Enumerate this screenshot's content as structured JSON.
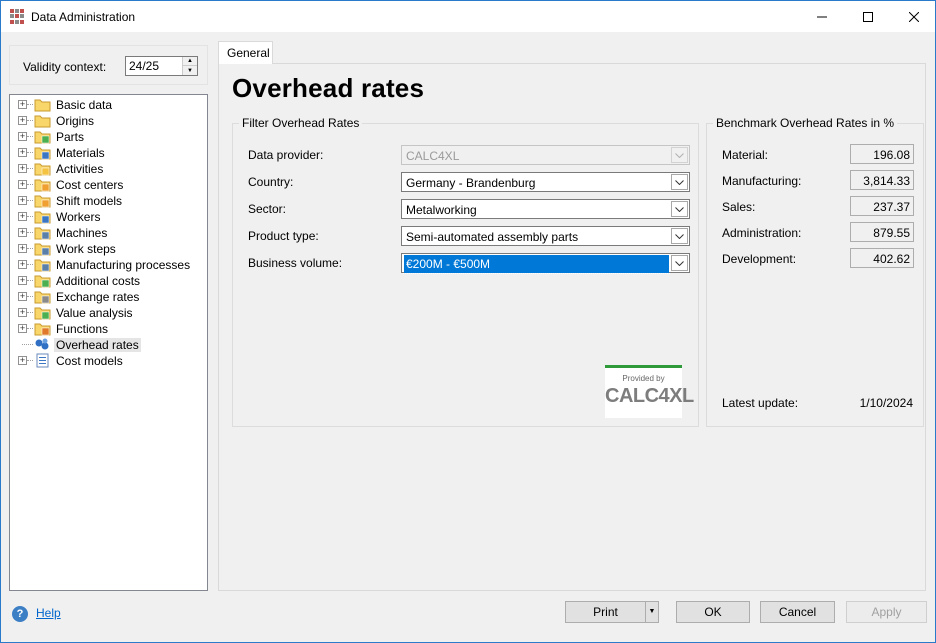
{
  "window": {
    "title": "Data Administration"
  },
  "validity": {
    "label": "Validity context:",
    "value": "24/25"
  },
  "tree": {
    "items": [
      {
        "label": "Basic data",
        "icon": "folder-icon"
      },
      {
        "label": "Origins",
        "icon": "folder-icon"
      },
      {
        "label": "Parts",
        "icon": "parts-folder-icon"
      },
      {
        "label": "Materials",
        "icon": "materials-folder-icon"
      },
      {
        "label": "Activities",
        "icon": "activities-folder-icon"
      },
      {
        "label": "Cost centers",
        "icon": "cost-centers-folder-icon"
      },
      {
        "label": "Shift models",
        "icon": "shift-models-folder-icon"
      },
      {
        "label": "Workers",
        "icon": "workers-folder-icon"
      },
      {
        "label": "Machines",
        "icon": "machines-folder-icon"
      },
      {
        "label": "Work steps",
        "icon": "work-steps-folder-icon"
      },
      {
        "label": "Manufacturing processes",
        "icon": "manufacturing-folder-icon"
      },
      {
        "label": "Additional costs",
        "icon": "additional-costs-folder-icon"
      },
      {
        "label": "Exchange rates",
        "icon": "exchange-rates-folder-icon"
      },
      {
        "label": "Value analysis",
        "icon": "value-analysis-folder-icon"
      },
      {
        "label": "Functions",
        "icon": "functions-folder-icon"
      },
      {
        "label": "Overhead rates",
        "icon": "overhead-rates-icon",
        "selected": true
      },
      {
        "label": "Cost models",
        "icon": "cost-models-icon"
      }
    ]
  },
  "tab": {
    "label": "General"
  },
  "page": {
    "title": "Overhead rates"
  },
  "filter": {
    "title": "Filter Overhead Rates",
    "fields": [
      {
        "label": "Data provider:",
        "value": "CALC4XL",
        "disabled": true
      },
      {
        "label": "Country:",
        "value": "Germany - Brandenburg"
      },
      {
        "label": "Sector:",
        "value": "Metalworking"
      },
      {
        "label": "Product type:",
        "value": "Semi-automated assembly parts"
      },
      {
        "label": "Business volume:",
        "value": "€200M - €500M",
        "selected": true
      }
    ],
    "logo": {
      "provided_by": "Provided by",
      "brand": "CALC4XL"
    }
  },
  "benchmark": {
    "title": "Benchmark Overhead Rates in %",
    "rows": [
      {
        "label": "Material:",
        "value": "196.08"
      },
      {
        "label": "Manufacturing:",
        "value": "3,814.33"
      },
      {
        "label": "Sales:",
        "value": "237.37"
      },
      {
        "label": "Administration:",
        "value": "879.55"
      },
      {
        "label": "Development:",
        "value": "402.62"
      }
    ],
    "latest_label": "Latest update:",
    "latest_value": "1/10/2024"
  },
  "footer": {
    "help": "Help",
    "print": "Print",
    "ok": "OK",
    "cancel": "Cancel",
    "apply": "Apply"
  },
  "colors": {
    "accent": "#0078d7",
    "selection_bg": "#e5e5e5",
    "link": "#0066cc",
    "logo_green": "#2f9a3a"
  }
}
